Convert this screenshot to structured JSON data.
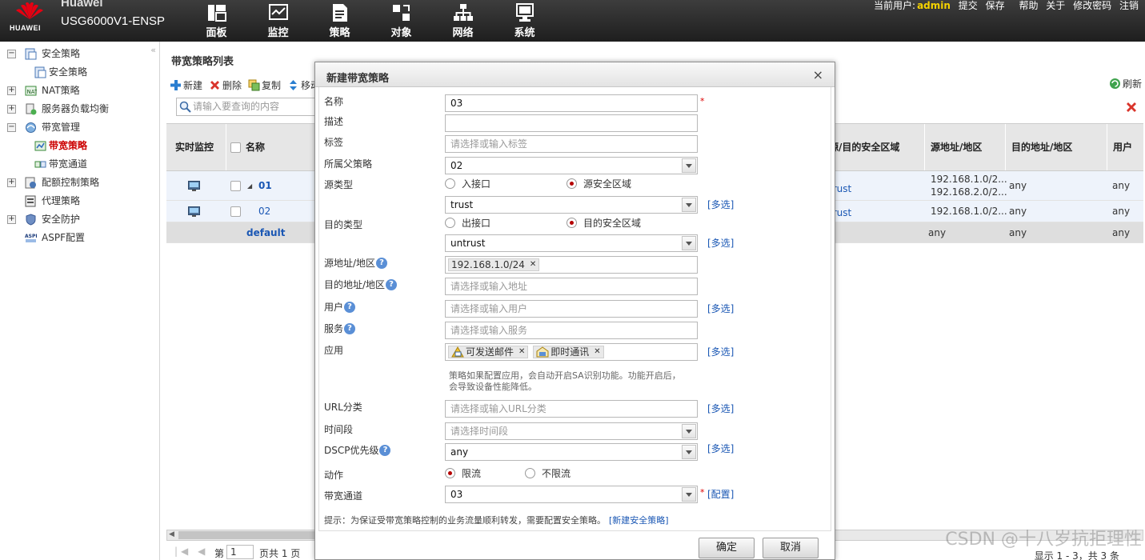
{
  "brand": {
    "logo_text": "HUAWEI",
    "vendor": "Huawei",
    "model": "USG6000V1-ENSP"
  },
  "nav": [
    {
      "label": "面板",
      "icon": "dashboard-icon"
    },
    {
      "label": "监控",
      "icon": "monitor-icon"
    },
    {
      "label": "策略",
      "icon": "policy-icon"
    },
    {
      "label": "对象",
      "icon": "object-icon"
    },
    {
      "label": "网络",
      "icon": "network-icon"
    },
    {
      "label": "系统",
      "icon": "system-icon"
    }
  ],
  "user": {
    "prefix": "当前用户:",
    "name": "admin",
    "submit": "提交",
    "save": "保存",
    "help": "帮助",
    "about": "关于",
    "change_password": "修改密码",
    "logout": "注销"
  },
  "sidebar": {
    "items": [
      {
        "label": "安全策略",
        "toggle": "−",
        "icon": "security-policy-icon"
      },
      {
        "label": "安全策略",
        "child": true,
        "icon": "policy-page-icon"
      },
      {
        "label": "NAT策略",
        "toggle": "+",
        "icon": "nat-icon"
      },
      {
        "label": "服务器负载均衡",
        "toggle": "+",
        "icon": "server-lb-icon"
      },
      {
        "label": "带宽管理",
        "toggle": "−",
        "icon": "bandwidth-icon"
      },
      {
        "label": "带宽策略",
        "child": true,
        "selected": true,
        "icon": "bandwidth-policy-icon"
      },
      {
        "label": "带宽通道",
        "child": true,
        "icon": "bandwidth-channel-icon"
      },
      {
        "label": "配额控制策略",
        "toggle": "+",
        "icon": "quota-icon"
      },
      {
        "label": "代理策略",
        "icon": "proxy-icon"
      },
      {
        "label": "安全防护",
        "toggle": "+",
        "icon": "shield-icon"
      },
      {
        "label": "ASPF配置",
        "icon": "aspf-icon"
      }
    ]
  },
  "list": {
    "title": "带宽策略列表",
    "toolbar": {
      "new": "新建",
      "delete": "删除",
      "copy": "复制",
      "move": "移动",
      "refresh": "刷新"
    },
    "search_placeholder": "请输入要查询的内容",
    "columns": {
      "monitor": "实时监控",
      "name": "名称",
      "zone": "源/目的安全区域",
      "src_addr": "源地址/地区",
      "dst_addr": "目的地址/地区",
      "user": "用户"
    },
    "rows": [
      {
        "name": "01",
        "expand": "◢",
        "zone": "trust",
        "src1": "192.168.1.0/2...",
        "src2": "192.168.2.0/2...",
        "dst": "any",
        "user": "any"
      },
      {
        "name": "02",
        "zone": "trust",
        "src1": "192.168.1.0/2...",
        "dst": "any",
        "user": "any"
      },
      {
        "name": "default",
        "src1": "any",
        "dst": "any",
        "user": "any"
      }
    ],
    "pager": {
      "prefix": "第",
      "page": "1",
      "total": "页共 1 页",
      "info": "显示 1 - 3，共 3 条"
    }
  },
  "modal": {
    "title": "新建带宽策略",
    "close": "×",
    "labels": {
      "name": "名称",
      "desc": "描述",
      "tag": "标签",
      "parent": "所属父策略",
      "src_type": "源类型",
      "dst_type": "目的类型",
      "src_addr": "源地址/地区",
      "dst_addr": "目的地址/地区",
      "user": "用户",
      "service": "服务",
      "app": "应用",
      "url": "URL分类",
      "time": "时间段",
      "dscp": "DSCP优先级",
      "action": "动作",
      "channel": "带宽通道"
    },
    "values": {
      "name": "03",
      "desc": "",
      "parent": "02",
      "src_zone": "trust",
      "dst_zone": "untrust",
      "src_addr_tag": "192.168.1.0/24",
      "app_tag1": "可发送邮件",
      "app_tag2": "即时通讯",
      "dscp": "any",
      "channel": "03"
    },
    "placeholders": {
      "tag": "请选择或输入标签",
      "dst_addr": "请选择或输入地址",
      "user": "请选择或输入用户",
      "service": "请选择或输入服务",
      "url": "请选择或输入URL分类",
      "time": "请选择时间段"
    },
    "radios": {
      "ingress": "入接口",
      "src_zone": "源安全区域",
      "egress": "出接口",
      "dst_zone": "目的安全区域",
      "limit": "限流",
      "no_limit": "不限流"
    },
    "multi": "[多选]",
    "config": "[配置]",
    "required": "*",
    "help_mark": "?",
    "app_hint": "策略如果配置应用，会自动开启SA识别功能。功能开启后，会导致设备性能降低。",
    "tip": "提示：为保证受带宽策略控制的业务流量顺利转发，需要配置安全策略。",
    "tip_link": "[新建安全策略]",
    "ok": "确定",
    "cancel": "取消"
  },
  "watermark": "CSDN @十八岁抗拒理性",
  "colors": {
    "accent_red": "#b50000",
    "link_blue": "#1a57b4",
    "admin_yellow": "#f6d300"
  }
}
